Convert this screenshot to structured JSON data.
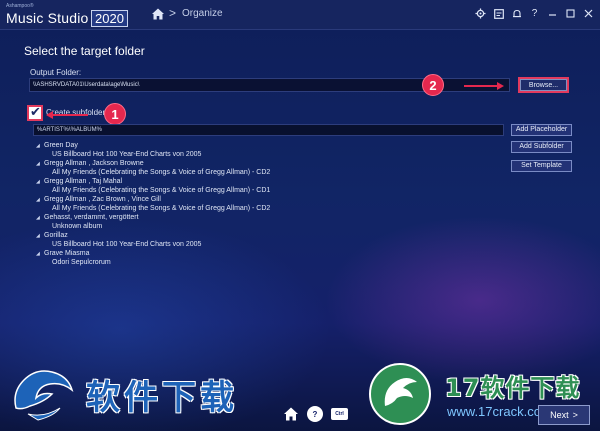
{
  "titlebar": {
    "vendor": "Ashampoo®",
    "app_name": "Music Studio",
    "year": "2020",
    "breadcrumb_sep": ">",
    "breadcrumb": "Organize",
    "icons": [
      "settings-icon",
      "preferences-icon",
      "notification-icon",
      "help-icon",
      "minimize-icon",
      "maximize-icon",
      "close-icon"
    ]
  },
  "page": {
    "title": "Select the target folder",
    "output_label": "Output Folder:",
    "output_path": "\\\\ASHSRVDATA01\\Userdata\\age\\Music\\",
    "browse_label": "Browse...",
    "subfolder_label": "Create subfolder",
    "subfolder_checked": true,
    "pattern_value": "%ARTIST%\\%ALBUM%",
    "add_placeholder_label": "Add Placeholder",
    "add_subfolder_label": "Add Subfolder",
    "set_template_label": "Set Template"
  },
  "annotations": {
    "badge_1": "1",
    "badge_2": "2"
  },
  "tree": [
    {
      "level": 0,
      "text": "Green Day"
    },
    {
      "level": 1,
      "text": "US Billboard Hot 100 Year-End Charts von 2005"
    },
    {
      "level": 0,
      "text": "Gregg Allman , Jackson Browne"
    },
    {
      "level": 1,
      "text": "All My Friends (Celebrating the Songs & Voice of Gregg Allman) - CD2"
    },
    {
      "level": 0,
      "text": "Gregg Allman , Taj Mahal"
    },
    {
      "level": 1,
      "text": "All My Friends (Celebrating the Songs & Voice of Gregg Allman) - CD1"
    },
    {
      "level": 0,
      "text": "Gregg Allman , Zac Brown , Vince Gill"
    },
    {
      "level": 1,
      "text": "All My Friends (Celebrating the Songs & Voice of Gregg Allman) - CD2"
    },
    {
      "level": 0,
      "text": "Gehasst, verdammt, vergöttert"
    },
    {
      "level": 1,
      "text": "Unknown album"
    },
    {
      "level": 0,
      "text": "Gorillaz"
    },
    {
      "level": 1,
      "text": "US Billboard Hot 100 Year-End Charts von 2005"
    },
    {
      "level": 0,
      "text": "Grave Miasma"
    },
    {
      "level": 1,
      "text": "Odori Sepulcrorum"
    }
  ],
  "footer": {
    "shortcut_key": "Ctrl",
    "help_glyph": "?",
    "next_label": "Next",
    "next_glyph": ">"
  },
  "watermark": {
    "left_text": "软件下载",
    "right_title": "17软件下载",
    "right_url": "www.17crack.com"
  },
  "colors": {
    "accent": "#e5284e",
    "background": "#112565",
    "titlebar": "#16255f"
  }
}
